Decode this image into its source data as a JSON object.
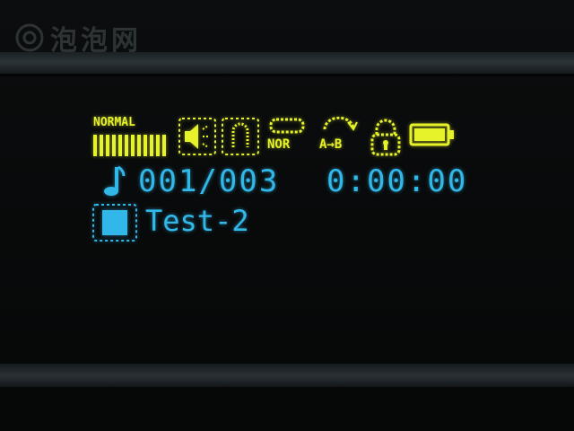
{
  "watermark": {
    "text": "泡泡网"
  },
  "status": {
    "eq_mode": "NORMAL",
    "play_mode": "NOR",
    "ab_repeat": "A→B",
    "battery": "full"
  },
  "player": {
    "track": "001/003",
    "time": "0:00:00",
    "title": "Test-2",
    "state": "stop"
  },
  "colors": {
    "status_yellow": "#e6f22a",
    "info_cyan": "#31b8e8",
    "background": "#07090a"
  },
  "icons": [
    "eq-bars-icon",
    "speaker-volume-icon",
    "mode-frame-icon",
    "repeat-icon",
    "ab-repeat-icon",
    "lock-icon",
    "battery-icon",
    "music-note-icon",
    "stop-icon"
  ]
}
